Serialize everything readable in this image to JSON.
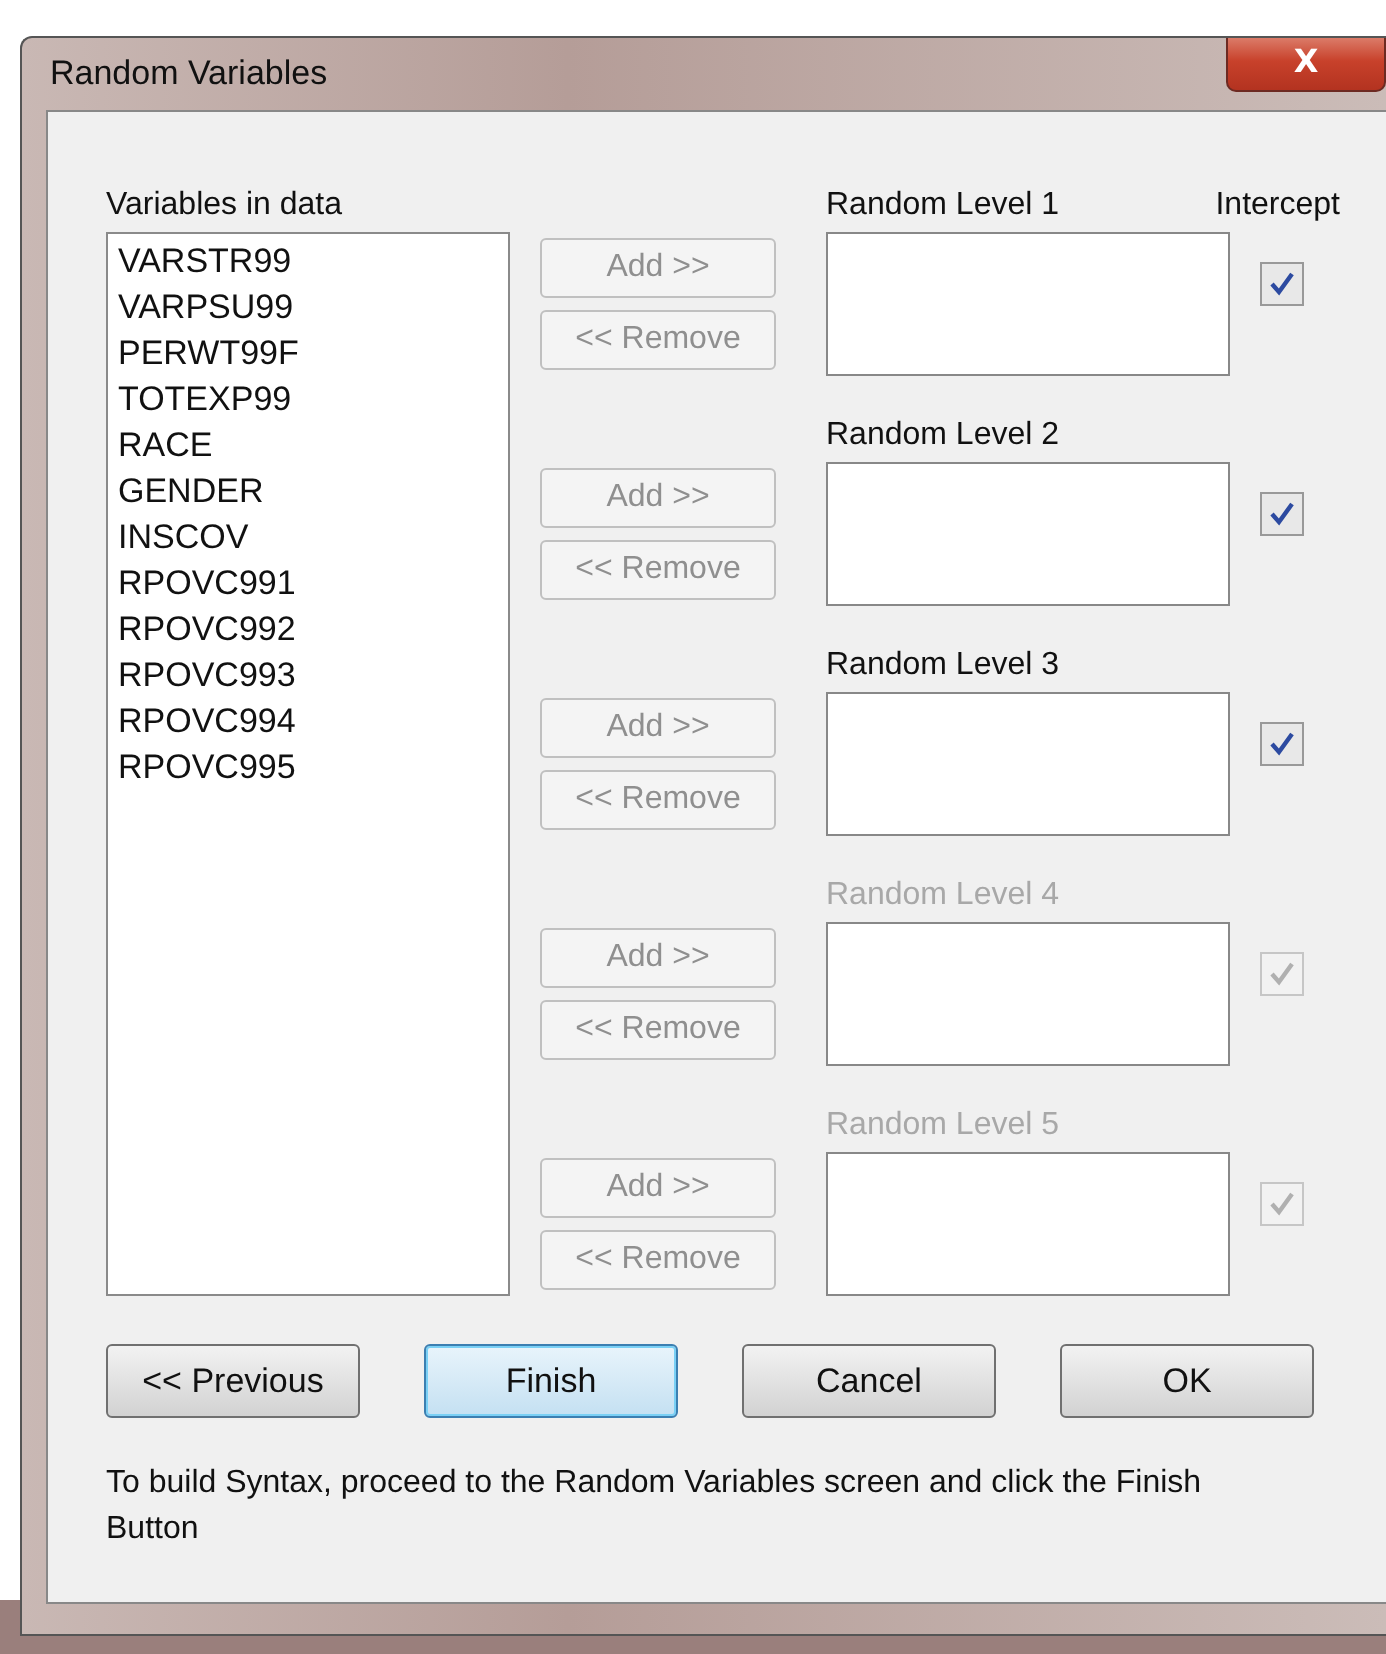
{
  "window": {
    "title": "Random Variables",
    "close_label": "X"
  },
  "variables": {
    "label": "Variables in data",
    "items": [
      "VARSTR99",
      "VARPSU99",
      "PERWT99F",
      "TOTEXP99",
      "RACE",
      "GENDER",
      "INSCOV",
      "RPOVC991",
      "RPOVC992",
      "RPOVC993",
      "RPOVC994",
      "RPOVC995"
    ]
  },
  "intercept_label": "Intercept",
  "levels": [
    {
      "label": "Random Level 1",
      "disabled": false,
      "intercept_checked": true,
      "add": "Add >>",
      "remove": "<< Remove"
    },
    {
      "label": "Random Level 2",
      "disabled": false,
      "intercept_checked": true,
      "add": "Add >>",
      "remove": "<< Remove"
    },
    {
      "label": "Random Level 3",
      "disabled": false,
      "intercept_checked": true,
      "add": "Add >>",
      "remove": "<< Remove"
    },
    {
      "label": "Random Level 4",
      "disabled": true,
      "intercept_checked": true,
      "add": "Add >>",
      "remove": "<< Remove"
    },
    {
      "label": "Random Level 5",
      "disabled": true,
      "intercept_checked": true,
      "add": "Add >>",
      "remove": "<< Remove"
    }
  ],
  "buttons": [
    {
      "label": "<< Previous",
      "default": false
    },
    {
      "label": "Finish",
      "default": true
    },
    {
      "label": "Cancel",
      "default": false
    },
    {
      "label": "OK",
      "default": false
    }
  ],
  "note": "To build  Syntax, proceed to the Random Variables screen and click the Finish Button"
}
